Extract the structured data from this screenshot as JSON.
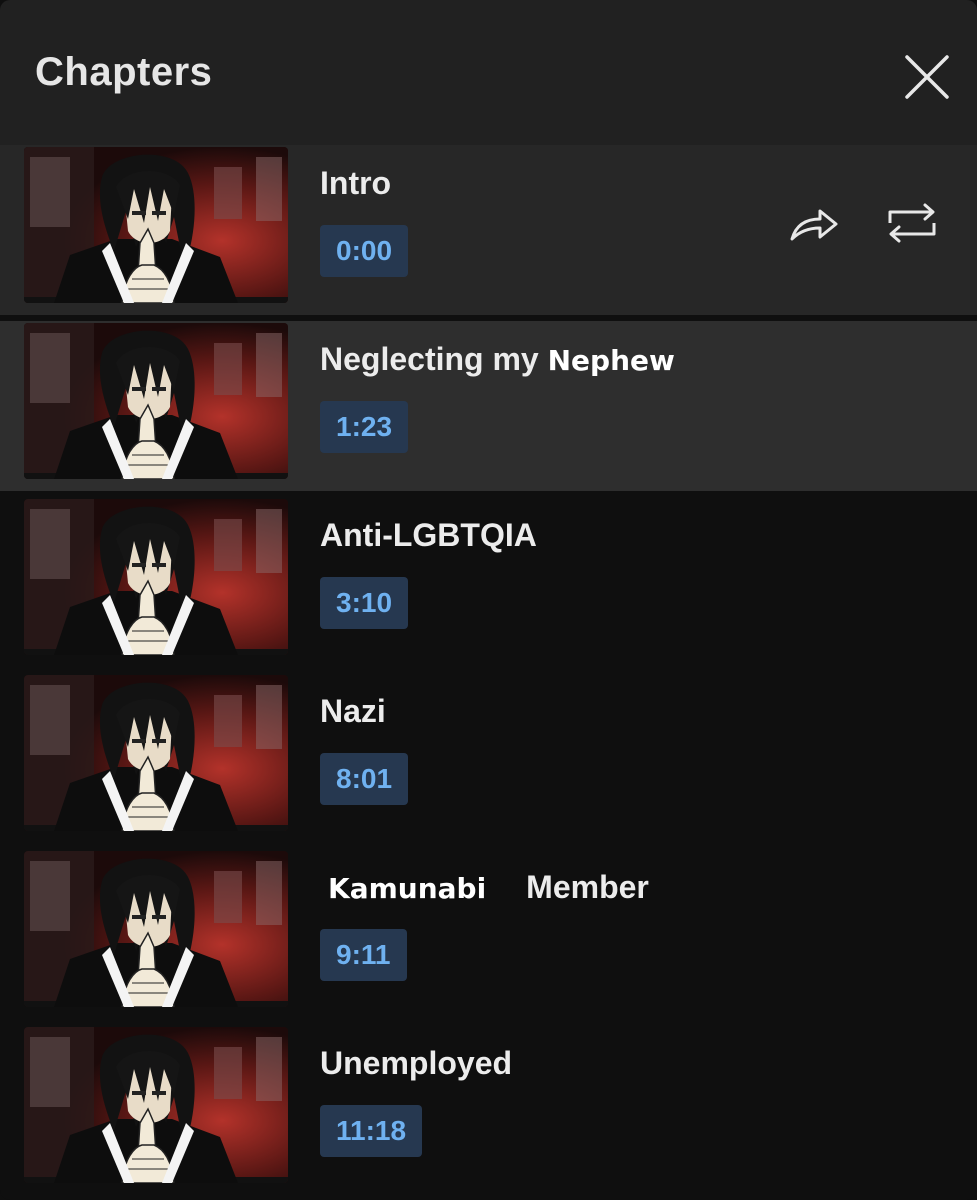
{
  "header": {
    "title": "Chapters",
    "close_icon": "close-icon"
  },
  "active_actions": {
    "share_icon": "share-icon",
    "loop_icon": "repeat-icon"
  },
  "chapters": [
    {
      "title": "Intro",
      "title_extra": "",
      "title_suffix": "",
      "time": "0:00"
    },
    {
      "title": "Neglecting my ",
      "title_extra": "Nephew",
      "title_suffix": "",
      "time": "1:23"
    },
    {
      "title": "Anti-LGBTQIA",
      "title_extra": "",
      "title_suffix": "",
      "time": "3:10"
    },
    {
      "title": "Nazi",
      "title_extra": "",
      "title_suffix": "",
      "time": "8:01"
    },
    {
      "title": "",
      "title_extra": "Kamunabi",
      "title_suffix": "Member",
      "time": "9:11"
    },
    {
      "title": "Unemployed",
      "title_extra": "",
      "title_suffix": "",
      "time": "11:18"
    }
  ],
  "colors": {
    "background": "#0f0f0f",
    "header": "#212121",
    "active_row": "#272727",
    "timestamp_bg": "#263850",
    "timestamp_text": "#6fb1f0"
  }
}
